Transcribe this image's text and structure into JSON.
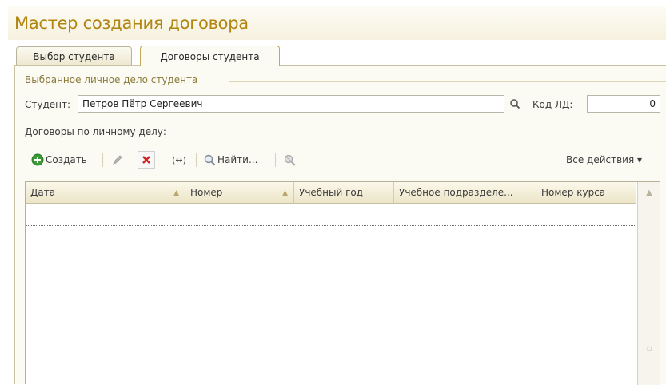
{
  "window": {
    "title": "Мастер создания договора"
  },
  "tabs": [
    {
      "label": "Выбор студента",
      "active": false
    },
    {
      "label": "Договоры студента",
      "active": true
    }
  ],
  "group": {
    "title": "Выбранное личное дело студента"
  },
  "student": {
    "label": "Студент:",
    "value": "Петров Пётр Сергеевич",
    "code_label": "Код ЛД:",
    "code_value": "0"
  },
  "contracts": {
    "label": "Договоры по личному делу:"
  },
  "toolbar": {
    "create_label": "Создать",
    "find_label": "Найти...",
    "all_actions_label": "Все действия ▾"
  },
  "table": {
    "columns": [
      "Дата",
      "Номер",
      "Учебный год",
      "Учебное подразделе...",
      "Номер курса"
    ],
    "rows": []
  },
  "colors": {
    "accent": "#b08510",
    "create_icon": "#3a9a35",
    "delete_icon": "#d02020"
  }
}
